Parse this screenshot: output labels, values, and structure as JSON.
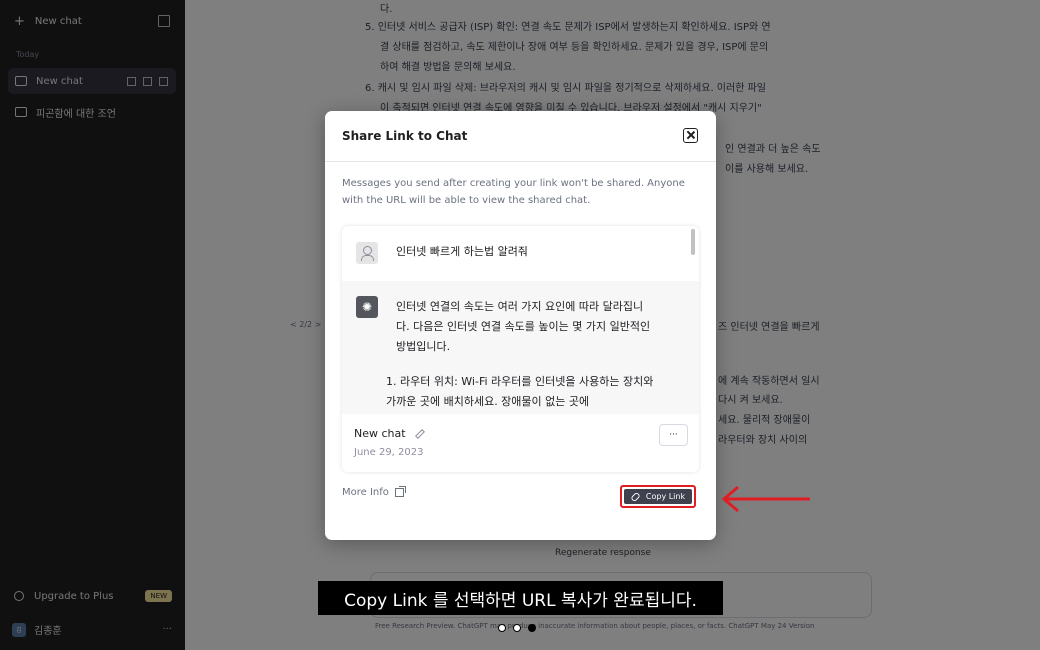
{
  "sidebar": {
    "new_chat": "New chat",
    "section": "Today",
    "items": [
      {
        "label": "New chat"
      },
      {
        "label": "피곤함에 대한 조언"
      }
    ],
    "upgrade": "Upgrade to Plus",
    "upgrade_badge": "NEW",
    "user": "김종훈"
  },
  "main": {
    "lines": [
      "다.",
      "5. 인터넷 서비스 공급자 (ISP) 확인: 연결 속도 문제가 ISP에서 발생하는지 확인하세요. ISP와 연",
      "결 상태를 점검하고, 속도 제한이나 장애 여부 등을 확인하세요. 문제가 있을 경우, ISP에 문의",
      "하여 해결 방법을 문의해 보세요.",
      "6. 캐시 및 임시 파일 삭제: 브라우저의 캐시 및 임시 파일을 정기적으로 삭제하세요. 이러한 파일",
      "이 축적되면 인터넷 연결 속도에 영향을 미칠 수 있습니다. 브라우저 설정에서 \"캐시 지우기\"",
      "인 연결과 더 높은 속도",
      "이를 사용해 보세요.",
      "< 2/2 >",
      "즈 인터넷 연결을 빠르게",
      "에 계속 작동하면서 일시",
      "다시 켜 보세요.",
      "세요. 물리적 장애물이",
      "라우터와 장치 사이의"
    ],
    "regenerate": "Regenerate response",
    "footer": "Free Research Preview. ChatGPT may produce inaccurate information about people, places, or facts. ChatGPT May 24 Version"
  },
  "modal": {
    "title": "Share Link to Chat",
    "description": "Messages you send after creating your link won't be shared. Anyone with the URL will be able to view the shared chat.",
    "user_message": "인터넷 빠르게 하는법 알려줘",
    "bot_message": "인터넷 연결의 속도는 여러 가지 요인에 따라 달라집니다. 다음은 인터넷 연결 속도를 높이는 몇 가지 일반적인 방법입니다.",
    "bot_list_item": "1.  라우터 위치: Wi-Fi 라우터를 인터넷을 사용하는 장치와 가까운 곳에 배치하세요. 장애물이 없는 곳에",
    "chat_title": "New chat",
    "chat_date": "June 29, 2023",
    "more_menu": "···",
    "more_info": "More Info",
    "copy_link": "Copy Link"
  },
  "caption": "Copy Link 를 선택하면 URL 복사가 완료됩니다.",
  "colors": {
    "highlight": "#e11d24",
    "button": "#40414f",
    "sidebar": "#202123"
  }
}
